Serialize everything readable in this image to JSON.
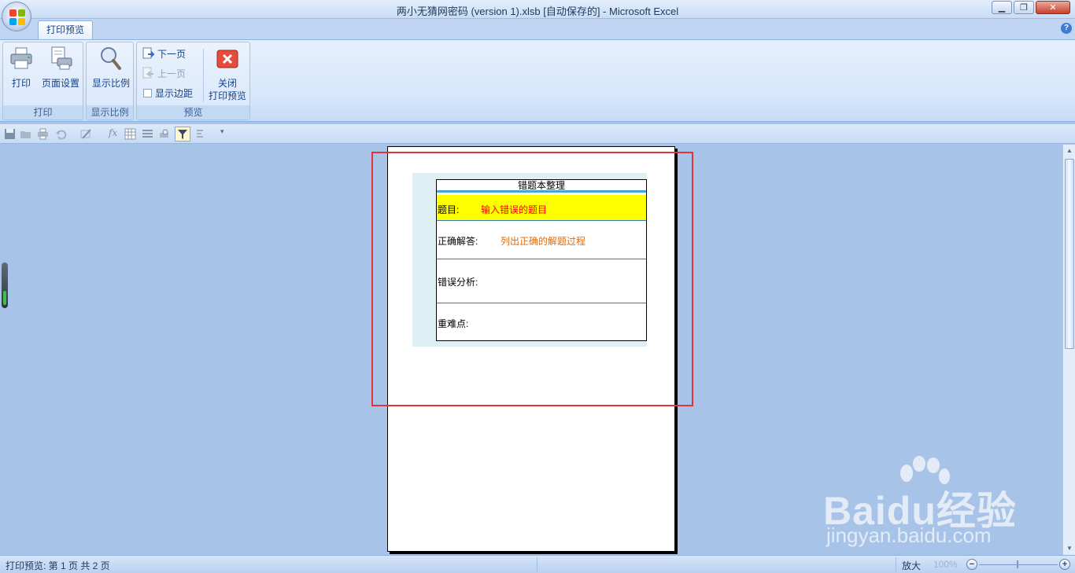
{
  "window": {
    "title": "两小无猜网密码 (version 1).xlsb [自动保存的] - Microsoft Excel",
    "minimize": "▁",
    "restore": "❐",
    "close": "✕"
  },
  "tabs": [
    {
      "label": "打印预览"
    }
  ],
  "help": "?",
  "ribbon": {
    "groups": [
      {
        "label": "打印",
        "buttons": [
          "打印",
          "页面设置"
        ]
      },
      {
        "label": "显示比例",
        "buttons": [
          "显示比例"
        ]
      },
      {
        "label": "预览",
        "buttons": [
          "下一页",
          "上一页",
          "显示边距",
          "关闭",
          "打印预览"
        ]
      }
    ]
  },
  "page": {
    "table_title": "错题本整理",
    "rows": [
      {
        "label": "题目:",
        "value": "输入错误的题目"
      },
      {
        "label": "正确解答:",
        "value": "列出正确的解题过程"
      },
      {
        "label": "错误分析:",
        "value": ""
      },
      {
        "label": "重难点:",
        "value": ""
      }
    ]
  },
  "status": {
    "left": "打印预览: 第 1 页  共 2 页",
    "zoom_in": "放大",
    "zoom_pct": "100%",
    "minus": "−",
    "plus": "+"
  },
  "watermark": {
    "text": "Baidu经验",
    "sub": "jingyan.baidu.com"
  },
  "colors": {
    "question_bg": "#ffff00",
    "question_text": "#ff0000",
    "answer_text": "#e26b0a",
    "highlight_box": "#e0343a"
  }
}
